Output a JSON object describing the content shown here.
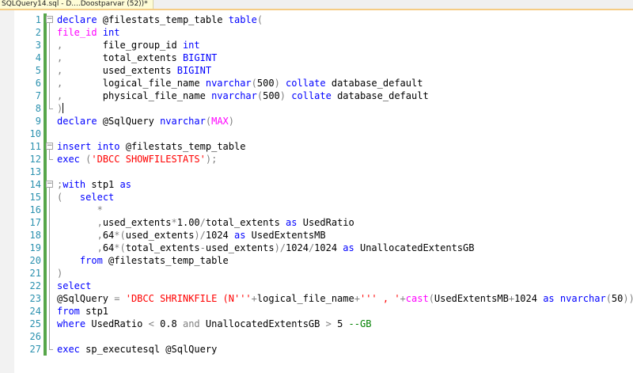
{
  "tab": {
    "title": "SQLQuery14.sql - D....Doostparvar (52))*"
  },
  "editor": {
    "line_numbers": [
      "1",
      "2",
      "3",
      "4",
      "5",
      "6",
      "7",
      "8",
      "9",
      "10",
      "11",
      "12",
      "13",
      "14",
      "15",
      "16",
      "17",
      "18",
      "19",
      "20",
      "21",
      "22",
      "23",
      "24",
      "25",
      "26",
      "27"
    ],
    "lines": [
      [
        [
          "kw",
          "declare"
        ],
        [
          "txt",
          " @filestats_temp_table "
        ],
        [
          "kw",
          "table"
        ],
        [
          "gr",
          "("
        ]
      ],
      [
        [
          "fn",
          "file_id"
        ],
        [
          "txt",
          " "
        ],
        [
          "kw",
          "int"
        ]
      ],
      [
        [
          "gr",
          ","
        ],
        [
          "txt",
          "       file_group_id "
        ],
        [
          "kw",
          "int"
        ]
      ],
      [
        [
          "gr",
          ","
        ],
        [
          "txt",
          "       total_extents "
        ],
        [
          "kw",
          "BIGINT"
        ]
      ],
      [
        [
          "gr",
          ","
        ],
        [
          "txt",
          "       used_extents "
        ],
        [
          "kw",
          "BIGINT"
        ]
      ],
      [
        [
          "gr",
          ","
        ],
        [
          "txt",
          "       logical_file_name "
        ],
        [
          "kw",
          "nvarchar"
        ],
        [
          "gr",
          "("
        ],
        [
          "txt",
          "500"
        ],
        [
          "gr",
          ")"
        ],
        [
          "txt",
          " "
        ],
        [
          "kw",
          "collate"
        ],
        [
          "txt",
          " database_default"
        ]
      ],
      [
        [
          "gr",
          ","
        ],
        [
          "txt",
          "       physical_file_name "
        ],
        [
          "kw",
          "nvarchar"
        ],
        [
          "gr",
          "("
        ],
        [
          "txt",
          "500"
        ],
        [
          "gr",
          ")"
        ],
        [
          "txt",
          " "
        ],
        [
          "kw",
          "collate"
        ],
        [
          "txt",
          " database_default"
        ]
      ],
      [
        [
          "gr",
          ")"
        ],
        [
          "caret",
          ""
        ]
      ],
      [
        [
          "kw",
          "declare"
        ],
        [
          "txt",
          " @SqlQuery "
        ],
        [
          "kw",
          "nvarchar"
        ],
        [
          "gr",
          "("
        ],
        [
          "fn",
          "MAX"
        ],
        [
          "gr",
          ")"
        ]
      ],
      [],
      [
        [
          "kw",
          "insert"
        ],
        [
          "txt",
          " "
        ],
        [
          "kw",
          "into"
        ],
        [
          "txt",
          " @filestats_temp_table"
        ]
      ],
      [
        [
          "kw",
          "exec"
        ],
        [
          "txt",
          " "
        ],
        [
          "gr",
          "("
        ],
        [
          "st",
          "'DBCC SHOWFILESTATS'"
        ],
        [
          "gr",
          ");"
        ]
      ],
      [],
      [
        [
          "gr",
          ";"
        ],
        [
          "kw",
          "with"
        ],
        [
          "txt",
          " stp1 "
        ],
        [
          "kw",
          "as"
        ]
      ],
      [
        [
          "gr",
          "("
        ],
        [
          "txt",
          "   "
        ],
        [
          "kw",
          "select"
        ]
      ],
      [
        [
          "txt",
          "       "
        ],
        [
          "gr",
          "*"
        ]
      ],
      [
        [
          "txt",
          "       "
        ],
        [
          "gr",
          ","
        ],
        [
          "txt",
          "used_extents"
        ],
        [
          "gr",
          "*"
        ],
        [
          "txt",
          "1.00"
        ],
        [
          "gr",
          "/"
        ],
        [
          "txt",
          "total_extents "
        ],
        [
          "kw",
          "as"
        ],
        [
          "txt",
          " UsedRatio"
        ]
      ],
      [
        [
          "txt",
          "       "
        ],
        [
          "gr",
          ","
        ],
        [
          "txt",
          "64"
        ],
        [
          "gr",
          "*("
        ],
        [
          "txt",
          "used_extents"
        ],
        [
          "gr",
          ")/"
        ],
        [
          "txt",
          "1024 "
        ],
        [
          "kw",
          "as"
        ],
        [
          "txt",
          " UsedExtentsMB"
        ]
      ],
      [
        [
          "txt",
          "       "
        ],
        [
          "gr",
          ","
        ],
        [
          "txt",
          "64"
        ],
        [
          "gr",
          "*("
        ],
        [
          "txt",
          "total_extents"
        ],
        [
          "gr",
          "-"
        ],
        [
          "txt",
          "used_extents"
        ],
        [
          "gr",
          ")/"
        ],
        [
          "txt",
          "1024"
        ],
        [
          "gr",
          "/"
        ],
        [
          "txt",
          "1024 "
        ],
        [
          "kw",
          "as"
        ],
        [
          "txt",
          " UnallocatedExtentsGB"
        ]
      ],
      [
        [
          "txt",
          "    "
        ],
        [
          "kw",
          "from"
        ],
        [
          "txt",
          " @filestats_temp_table"
        ]
      ],
      [
        [
          "gr",
          ")"
        ]
      ],
      [
        [
          "kw",
          "select"
        ]
      ],
      [
        [
          "txt",
          "@SqlQuery "
        ],
        [
          "gr",
          "="
        ],
        [
          "txt",
          " "
        ],
        [
          "st",
          "'DBCC SHRINKFILE (N'''"
        ],
        [
          "gr",
          "+"
        ],
        [
          "txt",
          "logical_file_name"
        ],
        [
          "gr",
          "+"
        ],
        [
          "st",
          "''' , '"
        ],
        [
          "gr",
          "+"
        ],
        [
          "fn",
          "cast"
        ],
        [
          "gr",
          "("
        ],
        [
          "txt",
          "UsedExtentsMB"
        ],
        [
          "gr",
          "+"
        ],
        [
          "txt",
          "1024 "
        ],
        [
          "kw",
          "as"
        ],
        [
          "txt",
          " "
        ],
        [
          "kw",
          "nvarchar"
        ],
        [
          "gr",
          "("
        ],
        [
          "txt",
          "50"
        ],
        [
          "gr",
          "))+"
        ],
        [
          "st",
          "')'"
        ]
      ],
      [
        [
          "kw",
          "from"
        ],
        [
          "txt",
          " stp1"
        ]
      ],
      [
        [
          "kw",
          "where"
        ],
        [
          "txt",
          " UsedRatio "
        ],
        [
          "gr",
          "<"
        ],
        [
          "txt",
          " 0.8 "
        ],
        [
          "gr",
          "and"
        ],
        [
          "txt",
          " UnallocatedExtentsGB "
        ],
        [
          "gr",
          ">"
        ],
        [
          "txt",
          " 5 "
        ],
        [
          "cm",
          "--GB"
        ]
      ],
      [],
      [
        [
          "kw",
          "exec"
        ],
        [
          "txt",
          " sp_executesql @SqlQuery"
        ]
      ]
    ]
  },
  "colors": {
    "keyword": "#0000ff",
    "function": "#ff00ff",
    "string": "#ff0000",
    "operator": "#808080",
    "comment": "#008000",
    "line_number": "#2b91af",
    "tab_background": "#fefcd6",
    "change_bar": "#57a64a"
  },
  "icons": {
    "fold_collapse": "minus-box-icon"
  }
}
